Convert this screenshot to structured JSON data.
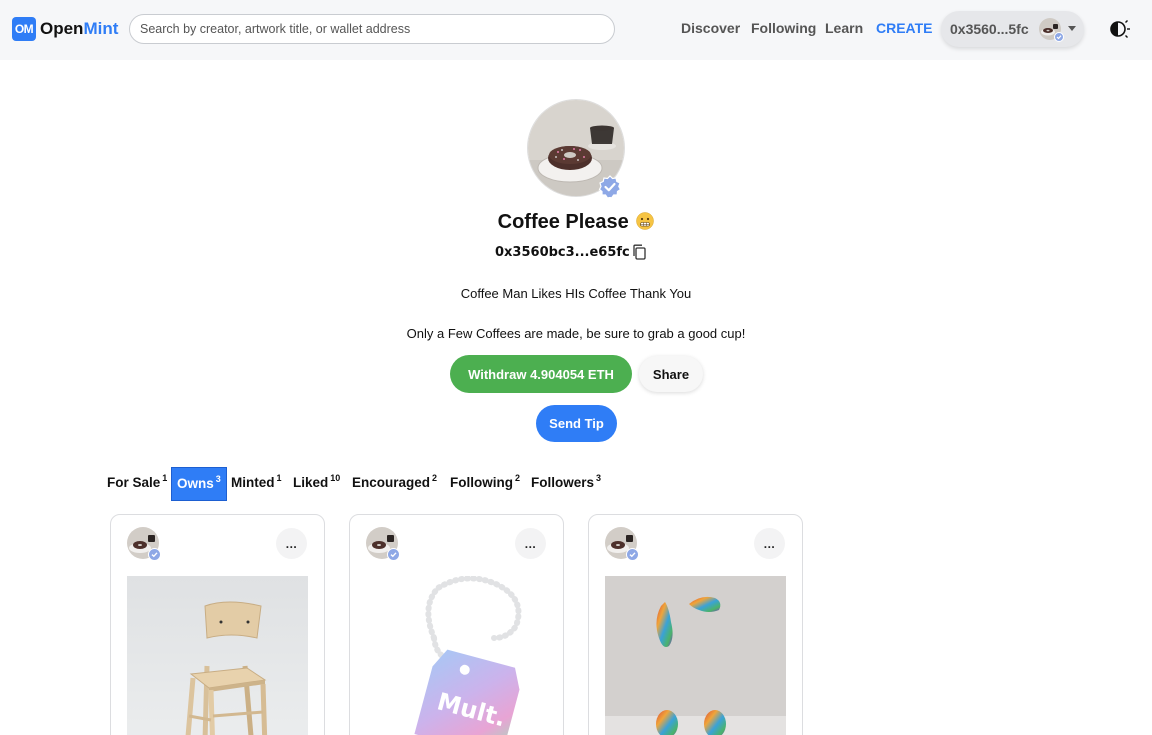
{
  "header": {
    "logo_badge": "OM",
    "logo_open": "Open",
    "logo_mint": "Mint",
    "search_placeholder": "Search by creator, artwork title, or wallet address",
    "nav": {
      "discover": "Discover",
      "following": "Following",
      "learn": "Learn",
      "create": "CREATE"
    },
    "wallet_address": "0x3560...5fc",
    "theme_icon": "half-moon-icon"
  },
  "profile": {
    "name": "Coffee Please",
    "address": "0x3560bc3...e65fc",
    "bio_line1": "Coffee Man Likes HIs Coffee Thank You",
    "bio_line2": "Only a Few Coffees are made, be sure to grab a good cup!",
    "withdraw_label": "Withdraw 4.904054 ETH",
    "share_label": "Share",
    "tip_label": "Send Tip"
  },
  "tabs": [
    {
      "label": "For Sale",
      "count": "1",
      "active": false
    },
    {
      "label": "Owns",
      "count": "3",
      "active": true
    },
    {
      "label": "Minted",
      "count": "1",
      "active": false
    },
    {
      "label": "Liked",
      "count": "10",
      "active": false
    },
    {
      "label": "Encouraged",
      "count": "2",
      "active": false
    },
    {
      "label": "Following",
      "count": "2",
      "active": false
    },
    {
      "label": "Followers",
      "count": "3",
      "active": false
    }
  ],
  "cards": [
    {
      "menu_label": "...",
      "image": "wooden-chair"
    },
    {
      "menu_label": "...",
      "image": "mult-tag"
    },
    {
      "menu_label": "...",
      "image": "fuzzy-creature"
    }
  ],
  "colors": {
    "accent": "#2f7df6",
    "success": "#4caf50",
    "header_bg": "#f6f7f9"
  }
}
